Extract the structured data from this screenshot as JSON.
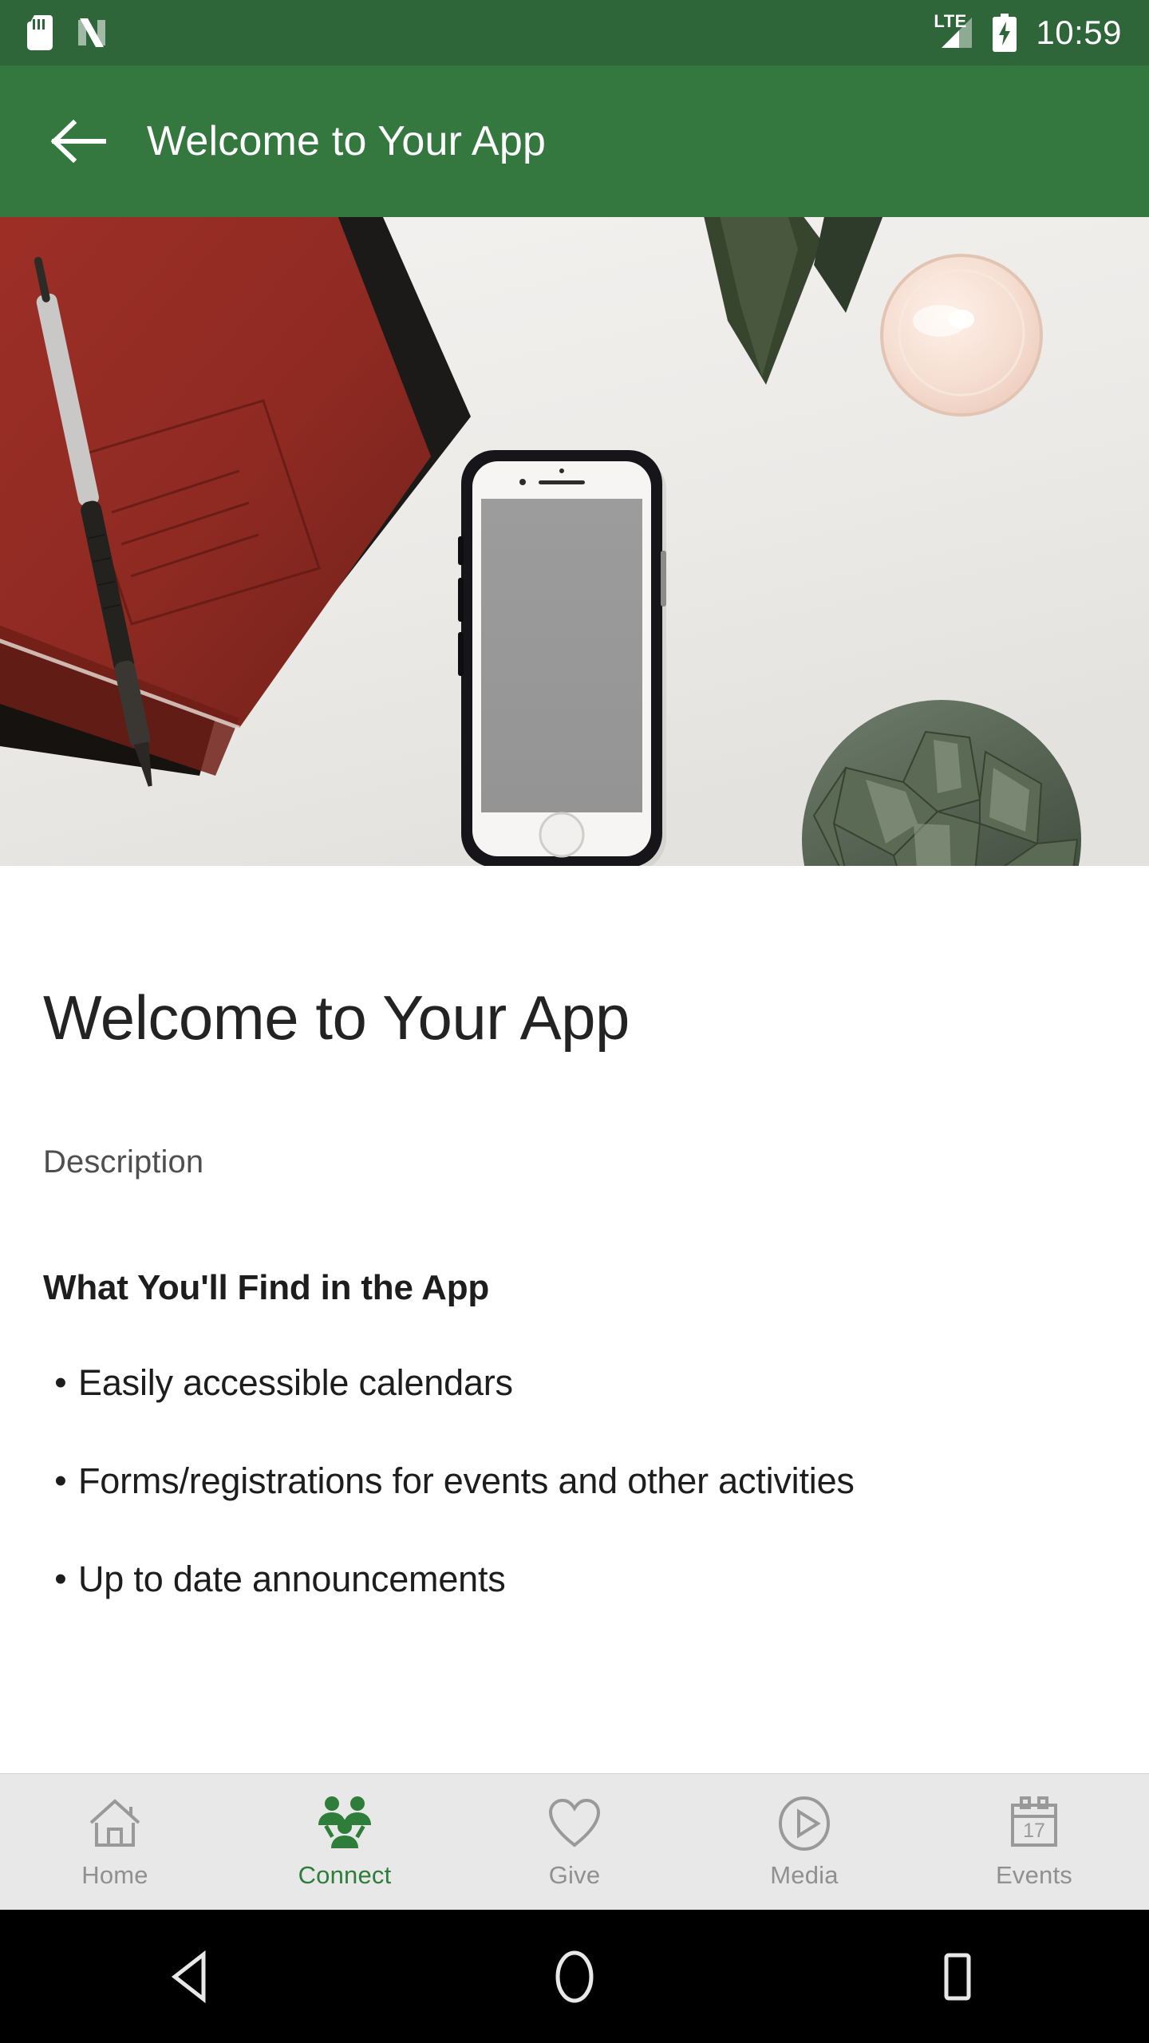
{
  "status_bar": {
    "background_color": "#2e6639",
    "icons": [
      "sd-card-icon",
      "nfc-icon"
    ],
    "network_label": "LTE",
    "battery_state": "charging",
    "time": "10:59"
  },
  "app_bar": {
    "background_color": "#347840",
    "back_icon": "back-arrow-icon",
    "title": "Welcome to Your App"
  },
  "hero": {
    "alt": "Flat lay photo of a red notebook with pen, white smartphone, candle and succulent on a white desk"
  },
  "content": {
    "page_title": "Welcome to Your App",
    "description_label": "Description",
    "body_heading": "What You'll Find in the App",
    "bullet_marker": "•",
    "bullets": [
      "Easily accessible calendars",
      "Forms/registrations for events and other activities",
      "Up to date announcements"
    ]
  },
  "bottom_nav": {
    "active_color": "#2e7d3a",
    "inactive_color": "#909090",
    "items": [
      {
        "label": "Home",
        "icon": "home-icon",
        "active": false
      },
      {
        "label": "Connect",
        "icon": "people-icon",
        "active": true
      },
      {
        "label": "Give",
        "icon": "heart-icon",
        "active": false
      },
      {
        "label": "Media",
        "icon": "play-circle-icon",
        "active": false
      },
      {
        "label": "Events",
        "icon": "calendar-icon",
        "active": false,
        "calendar_day": "17"
      }
    ]
  },
  "android_nav": {
    "background_color": "#000000",
    "buttons": [
      {
        "name": "back",
        "icon": "triangle-back-icon"
      },
      {
        "name": "home",
        "icon": "circle-home-icon"
      },
      {
        "name": "recents",
        "icon": "square-recents-icon"
      }
    ]
  }
}
